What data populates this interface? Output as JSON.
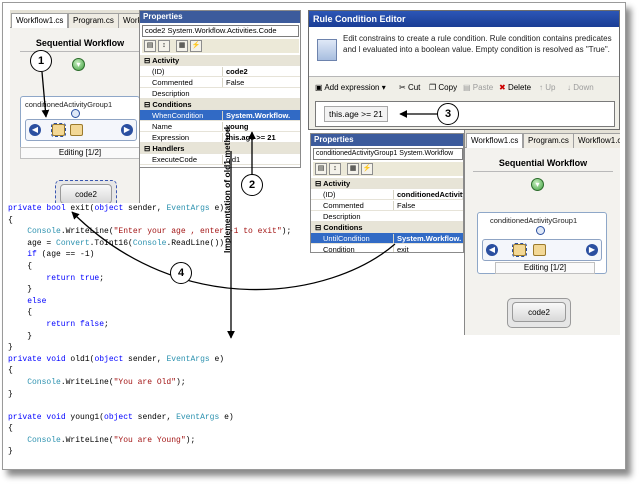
{
  "workflow_designer": {
    "tabs": [
      "Workflow1.cs",
      "Program.cs",
      "Workflow1.cs"
    ],
    "title": "Sequential Workflow",
    "activity_group": "conditionedActivityGroup1",
    "editing": "Editing [1/2]",
    "activity": "code2"
  },
  "properties_code2": {
    "title": "Properties",
    "selector": "code2  System.Workflow.Activities.Code",
    "categories": [
      {
        "label": "Activity",
        "rows": [
          {
            "k": "(ID)",
            "v": "code2"
          },
          {
            "k": "Commented",
            "v": "False"
          },
          {
            "k": "Description",
            "v": ""
          }
        ]
      },
      {
        "label": "Conditions",
        "rows": [
          {
            "k": "WhenCondition",
            "v": "System.Workflow."
          },
          {
            "k": "Name",
            "v": "young"
          },
          {
            "k": "Expression",
            "v": "this.age >= 21"
          }
        ]
      },
      {
        "label": "Handlers",
        "rows": [
          {
            "k": "ExecuteCode",
            "v": "old1"
          }
        ]
      }
    ]
  },
  "rule_editor": {
    "title": "Rule Condition Editor",
    "description": "Edit constrains to create a rule condition. Rule condition contains predicates and l evaluated into a boolean value. Empty condition is resolved as \"True\".",
    "toolbar": {
      "add": "Add expression",
      "cut": "Cut",
      "copy": "Copy",
      "paste": "Paste",
      "delete": "Delete",
      "up": "Up",
      "down": "Down"
    },
    "expression": "this.age  >=  21"
  },
  "properties_cag": {
    "title": "Properties",
    "selector": "conditionedActivityGroup1  System.Workflow",
    "categories": [
      {
        "label": "Activity",
        "rows": [
          {
            "k": "(ID)",
            "v": "conditionedActivityGro"
          },
          {
            "k": "Commented",
            "v": "False"
          },
          {
            "k": "Description",
            "v": ""
          }
        ]
      },
      {
        "label": "Conditions",
        "rows": [
          {
            "k": "UntilCondition",
            "v": "System.Workflow."
          },
          {
            "k": "Condition",
            "v": "exit"
          }
        ]
      }
    ]
  },
  "workflow_designer_2": {
    "tabs": [
      "Workflow1.cs",
      "Program.cs",
      "Workflow1.cs"
    ],
    "title": "Sequential Workflow",
    "activity_group": "conditionedActivityGroup1",
    "editing": "Editing [1/2]",
    "activity": "code2"
  },
  "code_lines": [
    "private bool exit(object sender, EventArgs e)",
    "{",
    "    Console.WriteLine(\"Enter your age , enter -1 to exit\");",
    "    age = Convert.ToInt16(Console.ReadLine());",
    "    if (age == -1)",
    "    {",
    "        return true;",
    "    }",
    "    else",
    "    {",
    "        return false;",
    "    }",
    "}",
    "private void old1(object sender, EventArgs e)",
    "{",
    "    Console.WriteLine(\"You are Old\");",
    "}",
    "",
    "private void young1(object sender, EventArgs e)",
    "{",
    "    Console.WriteLine(\"You are Young\");",
    "}"
  ],
  "annotations": {
    "callouts": [
      "1",
      "2",
      "3",
      "4"
    ],
    "vertical_label": "Implementation of old1 method"
  },
  "colors": {
    "keyword": "#0000ff",
    "type": "#2b91af",
    "string": "#a31515",
    "selection": "#316ac5",
    "title_bar": "#3c5b9c"
  }
}
